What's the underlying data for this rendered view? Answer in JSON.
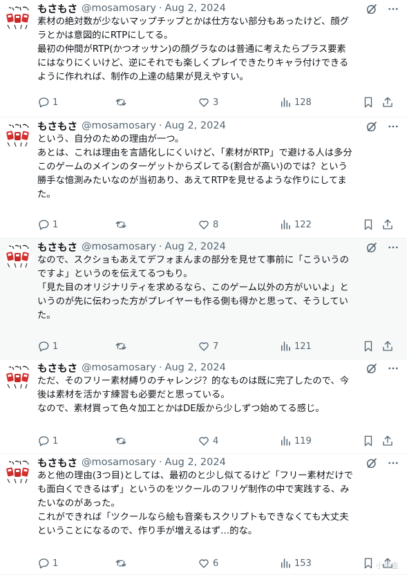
{
  "tweets": [
    {
      "name": "もさもさ",
      "handle": "@mosamosary",
      "separator": "·",
      "date": "Aug 2, 2024",
      "lines": [
        "素材の絶対数が少ないマップチップとかは仕方ない部分もあったけど、顔グ",
        "ラとかは意図的にRTPにしてる。",
        "最初の仲間がRTP(かつオッサン)の顔グラなのは普通に考えたらプラス要素",
        "にはなりにくいけど、逆にそれでも楽しくプレイできたりキャラ付けできる",
        "ように作れれば、制作の上達の結果が見えやすい。"
      ],
      "replies": "1",
      "retweets": "",
      "likes": "3",
      "views": "128"
    },
    {
      "name": "もさもさ",
      "handle": "@mosamosary",
      "separator": "·",
      "date": "Aug 2, 2024",
      "lines": [
        "という、自分のための理由が一つ。",
        "あとは、これは理由を言語化しにくいけど、「素材がRTP」で避ける人は多分",
        "このゲームのメインのターゲットからズレてる(割合が高い)のでは？という",
        "勝手な憶測みたいなのが当初あり、あえてRTPを見せるような作りにしてま",
        "た。"
      ],
      "replies": "1",
      "retweets": "",
      "likes": "8",
      "views": "122"
    },
    {
      "name": "もさもさ",
      "handle": "@mosamosary",
      "separator": "·",
      "date": "Aug 2, 2024",
      "lines": [
        "なので、スクショもあえてデフォまんまの部分を見せて事前に「こういうの",
        "ですよ」というのを伝えてるつもり。",
        "「見た目のオリジナリティを求めるなら、このゲーム以外の方がいいよ」と",
        "いうのが先に伝わった方がプレイヤーも作る側も得かと思って、そうしてい",
        "た。"
      ],
      "replies": "1",
      "retweets": "",
      "likes": "7",
      "views": "121"
    },
    {
      "name": "もさもさ",
      "handle": "@mosamosary",
      "separator": "·",
      "date": "Aug 2, 2024",
      "lines": [
        "ただ、そのフリー素材縛りのチャレンジ？的なものは既に完了したので、今",
        "後は素材を活かす練習も必要だと思っている。",
        "なので、素材買って色々加工とかはDE版から少しずつ始めてる感じ。"
      ],
      "replies": "1",
      "retweets": "",
      "likes": "4",
      "views": "119"
    },
    {
      "name": "もさもさ",
      "handle": "@mosamosary",
      "separator": "·",
      "date": "Aug 2, 2024",
      "lines": [
        "あと他の理由(3つ目)としては、最初のと少し似てるけど「フリー素材だけで",
        "も面白くできるはず」というのをツクールのフリゲ制作の中で実践する、み",
        "たいなのがあった。",
        "これができれば「ツクールなら絵も音楽もスクリプトもできなくても大丈夫",
        "ということになるので、作り手が増えるはず…的な。"
      ],
      "replies": "1",
      "retweets": "",
      "likes": "6",
      "views": "153"
    }
  ],
  "watermark": "小黑盒",
  "colors": {
    "text": "#0f1419",
    "muted": "#536471",
    "divider": "#eff3f4",
    "highlight_bg": "#f7f9f9",
    "avatar_red": "#d32f2f"
  }
}
